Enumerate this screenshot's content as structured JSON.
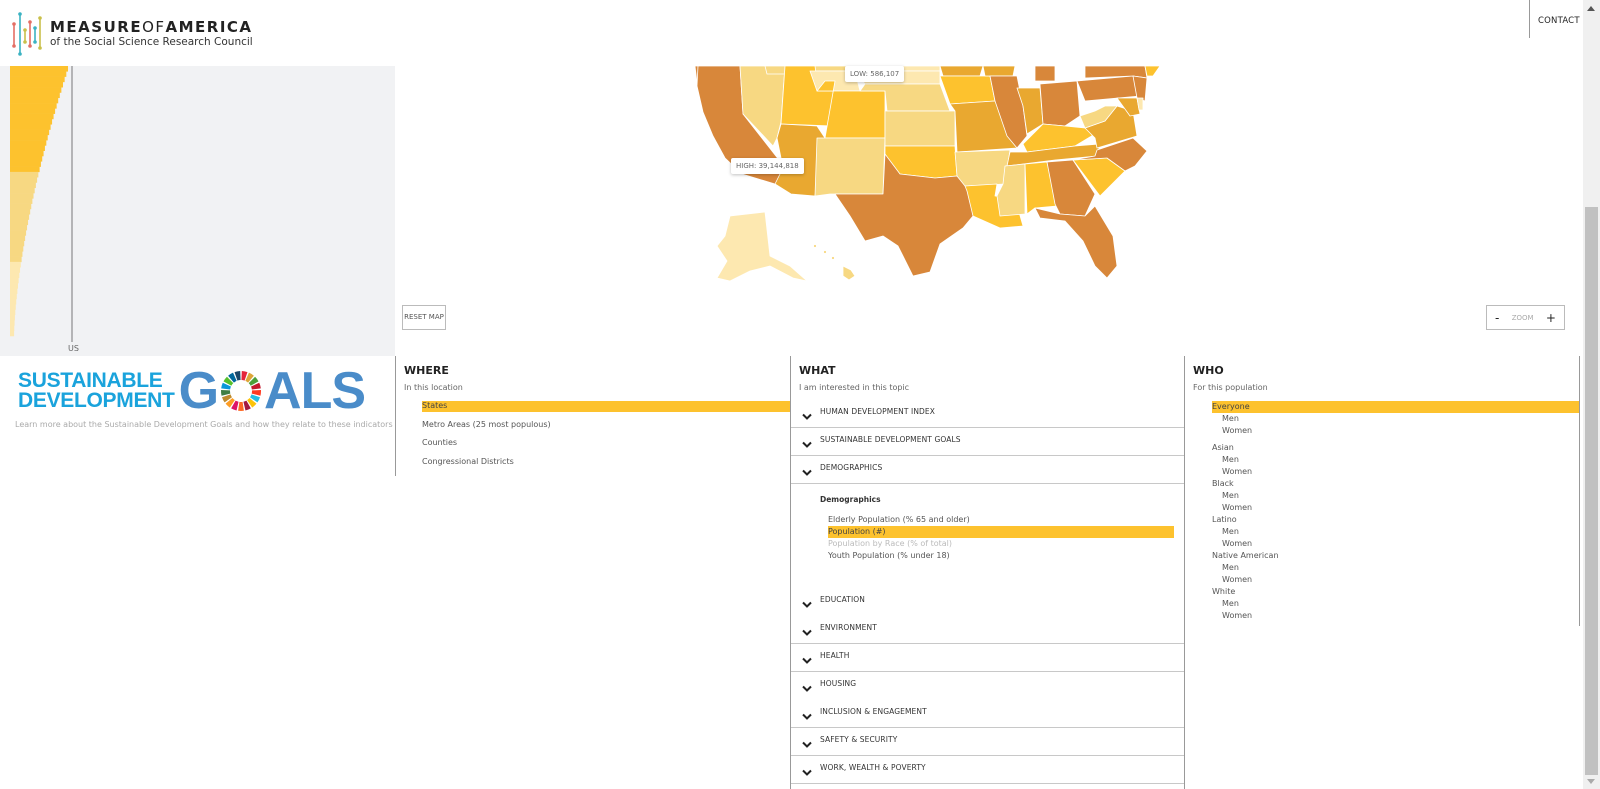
{
  "header": {
    "logo_title_1": "MEASURE",
    "logo_title_of": "OF",
    "logo_title_2": "AMERICA",
    "logo_subtitle": "of the Social Science Research Council",
    "contact_label": "CONTACT"
  },
  "colors": {
    "accent": "#fdc22e",
    "scale": [
      "#fde8b0",
      "#f7d882",
      "#fdc22e",
      "#e9a830",
      "#d8873a"
    ],
    "panel_bg": "#f1f2f4",
    "sdg_blue": "#1aa3dc",
    "sdg_goals": "#4a8cc9"
  },
  "bar_chart": {
    "reference_label": "US",
    "bins": [
      {
        "level": 2,
        "count": 20
      },
      {
        "level": 1,
        "count": 17
      },
      {
        "level": 0,
        "count": 14
      }
    ]
  },
  "map": {
    "high_label": "HIGH: 39,144,818",
    "low_label": "LOW: 586,107",
    "reset_label": "RESET MAP",
    "zoom_label": "ZOOM",
    "zoom_out": "-",
    "zoom_in": "+"
  },
  "sdg": {
    "line1": "SUSTAINABLE",
    "line2": "DEVELOPMENT",
    "goals_g": "G",
    "goals_rest": "ALS",
    "caption": "Learn more about the Sustainable Development Goals and how they relate to these indicators"
  },
  "where": {
    "title": "WHERE",
    "subtitle": "In this location",
    "items": [
      {
        "label": "States",
        "selected": true
      },
      {
        "label": "Metro Areas (25 most populous)",
        "selected": false
      },
      {
        "label": "Counties",
        "selected": false
      },
      {
        "label": "Congressional Districts",
        "selected": false
      }
    ]
  },
  "what": {
    "title": "WHAT",
    "subtitle": "I am interested in this topic",
    "topics": [
      {
        "label": "HUMAN DEVELOPMENT INDEX"
      },
      {
        "label": "SUSTAINABLE DEVELOPMENT GOALS"
      },
      {
        "label": "DEMOGRAPHICS",
        "expanded": true
      },
      {
        "label": "EDUCATION"
      },
      {
        "label": "ENVIRONMENT"
      },
      {
        "label": "HEALTH"
      },
      {
        "label": "HOUSING"
      },
      {
        "label": "INCLUSION & ENGAGEMENT"
      },
      {
        "label": "SAFETY & SECURITY"
      },
      {
        "label": "WORK, WEALTH & POVERTY"
      }
    ],
    "demographics": {
      "heading": "Demographics",
      "items": [
        {
          "label": "Elderly Population (% 65 and older)"
        },
        {
          "label": "Population (#)",
          "selected": true
        },
        {
          "label": "Population by Race (% of total)",
          "disabled": true
        },
        {
          "label": "Youth Population (% under 18)"
        }
      ]
    }
  },
  "who": {
    "title": "WHO",
    "subtitle": "For this population",
    "groups": [
      {
        "label": "Everyone",
        "selected": true,
        "children": [
          "Men",
          "Women"
        ]
      },
      {
        "label": "Asian",
        "children": [
          "Men",
          "Women"
        ]
      },
      {
        "label": "Black",
        "children": [
          "Men",
          "Women"
        ]
      },
      {
        "label": "Latino",
        "children": [
          "Men",
          "Women"
        ]
      },
      {
        "label": "Native American",
        "children": [
          "Men",
          "Women"
        ]
      },
      {
        "label": "White",
        "children": [
          "Men",
          "Women"
        ]
      }
    ]
  }
}
